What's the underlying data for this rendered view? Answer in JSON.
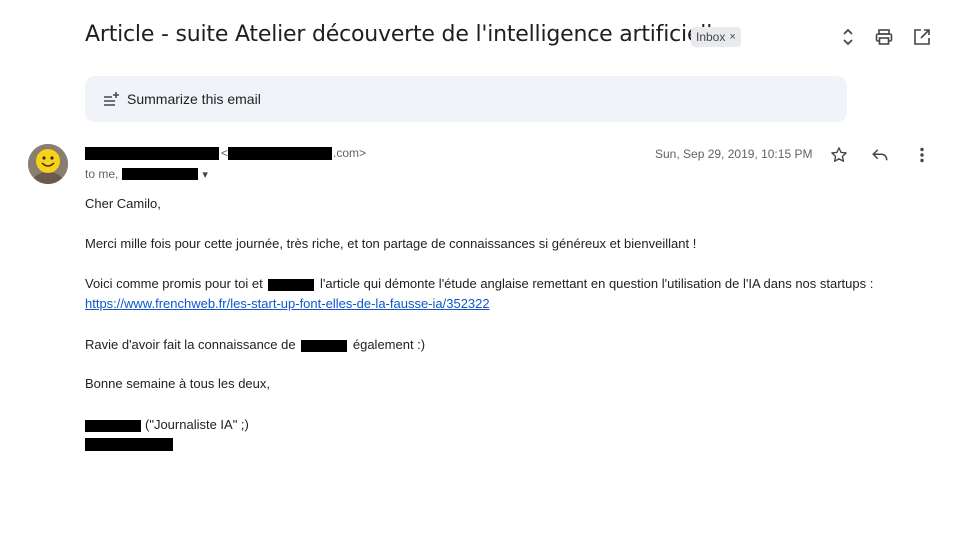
{
  "subject": "Article - suite Atelier découverte de l'intelligence artificielle",
  "label_chip": {
    "text": "Inbox",
    "remove": "×"
  },
  "summarize": {
    "label": "Summarize this email"
  },
  "sender": {
    "email_prefix": "<",
    "email_suffix": ".com>"
  },
  "recipient": {
    "prefix": "to me,",
    "dropdown": "▾"
  },
  "date": "Sun, Sep 29, 2019, 10:15 PM",
  "body": {
    "greeting": "Cher Camilo,",
    "line1": "Merci mille fois pour cette journée, très riche, et ton partage de connaissances si généreux et bienveillant !",
    "line2_a": "Voici comme promis pour toi et",
    "line2_b": "l'article qui démonte l'étude anglaise remettant en question l'utilisation de l'IA dans nos startups :",
    "link": "https://www.frenchweb.fr/les-start-up-font-elles-de-la-fausse-ia/352322",
    "line3_a": "Ravie d'avoir fait la connaissance de",
    "line3_b": "également :)",
    "line4": "Bonne semaine à tous les deux,",
    "signature_note": "(\"Journaliste IA\" ;)"
  },
  "icons": {
    "expand": "unfold-icon",
    "print": "print-icon",
    "open_new": "open-in-new-icon",
    "star": "star-icon",
    "reply": "reply-icon",
    "more": "more-vert-icon",
    "summarize": "summarize-sparkle-icon"
  }
}
